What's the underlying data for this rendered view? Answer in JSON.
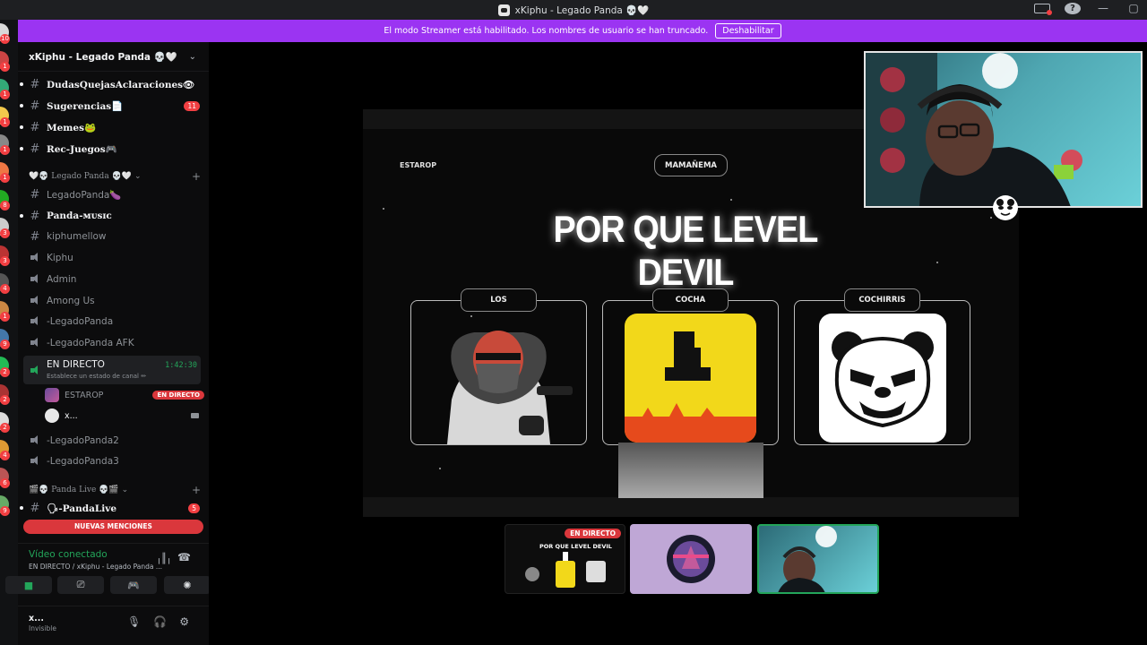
{
  "window": {
    "title": "xKiphu - Legado Panda 💀🤍"
  },
  "streamer_banner": {
    "message": "El modo Streamer está habilitado. Los nombres de usuario se han truncado.",
    "button": "Deshabilitar"
  },
  "server": {
    "name": "xKiphu - Legado Panda 💀🤍"
  },
  "channels_top": [
    {
      "name": "DudasQuejasAclaraciones👁",
      "type": "text"
    },
    {
      "name": "Sugerencias📄",
      "type": "text",
      "count": "11"
    },
    {
      "name": "Memes🐸",
      "type": "text"
    },
    {
      "name": "Rec-Juegos🎮",
      "type": "text"
    }
  ],
  "category_1": {
    "name": "🤍💀 Legado Panda 💀🤍"
  },
  "channels_mid": [
    {
      "name": "LegadoPanda🍆",
      "type": "text",
      "style": "dim"
    },
    {
      "name": "Panda-ᴍᴜsɪᴄ",
      "type": "text",
      "style": "bold"
    },
    {
      "name": "kiphumellow",
      "type": "text",
      "style": "dim"
    },
    {
      "name": "Kiphu",
      "type": "voice"
    },
    {
      "name": "Admin",
      "type": "voice"
    },
    {
      "name": "Among Us",
      "type": "voice"
    },
    {
      "name": "-LegadoPanda",
      "type": "voice"
    },
    {
      "name": "-LegadoPanda AFK",
      "type": "voice"
    }
  ],
  "live_channel": {
    "name": "EN DIRECTO",
    "time": "1:42:30",
    "status": "Establece un estado de canal ✏",
    "users": [
      {
        "name": "ESTAROP",
        "badge": "EN DIRECTO"
      },
      {
        "name": "x..."
      }
    ]
  },
  "channels_after_live": [
    {
      "name": "-LegadoPanda2",
      "type": "voice"
    },
    {
      "name": "-LegadoPanda3",
      "type": "voice"
    }
  ],
  "category_2": {
    "name": "🎬💀 Panda Live 💀🎬"
  },
  "channel_pandalive": {
    "name": "🗣-PandaLive",
    "count": "5"
  },
  "mentions_bar": "NUEVAS MENCIONES",
  "voice_panel": {
    "title": "Vídeo conectado",
    "subtitle": "EN DIRECTO / xKiphu - Legado Panda ..."
  },
  "user_panel": {
    "name": "x...",
    "status": "Invisible"
  },
  "rail_badges": [
    "10",
    "1",
    "1",
    "1",
    "1",
    "1",
    "8",
    "3",
    "3",
    "4",
    "1",
    "9",
    "2",
    "2",
    "2",
    "4",
    "6",
    "9"
  ],
  "stream": {
    "left_tag": "ESTAROP",
    "pill": "MAMAÑEMA",
    "title": "POR QUE LEVEL DEVIL",
    "cards": [
      "LOS",
      "COCHA",
      "COCHIRRIS"
    ]
  },
  "thumbnails": {
    "live_pill": "EN DIRECTO",
    "mini_title": "POR QUE LEVEL DEVIL"
  },
  "colors": {
    "accent": "#9b34f2",
    "live_red": "#da373c",
    "green": "#23a55a"
  }
}
